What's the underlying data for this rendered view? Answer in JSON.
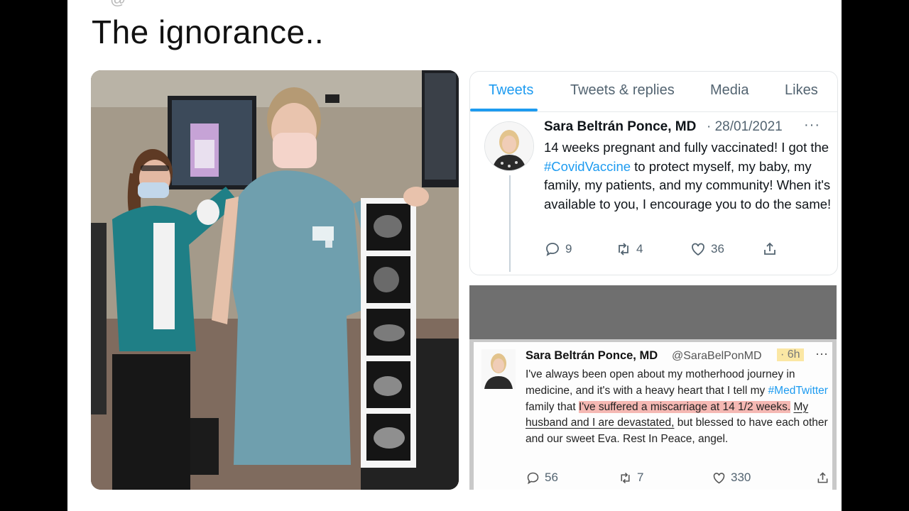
{
  "caption": "The ignorance..",
  "cut_header": "@",
  "profile": {
    "tabs": [
      "Tweets",
      "Tweets & replies",
      "Media",
      "Likes"
    ],
    "active_tab": "Tweets"
  },
  "tweet1": {
    "name": "Sara Beltrán Ponce, MD",
    "date": "· 28/01/2021",
    "more": "···",
    "body_before": "14 weeks pregnant and fully vaccinated! I got the ",
    "hashtag": "#CovidVaccine",
    "body_after": " to protect myself, my baby, my family, my patients, and my community! When it's available to you, I encourage you to do the same!",
    "replies": "9",
    "retweets": "4",
    "likes": "36"
  },
  "tweet2": {
    "name": "Sara Beltrán Ponce, MD",
    "handle": "@SaraBelPonMD",
    "time": "· 6h",
    "more": "···",
    "body_part1": "I've always been open about my motherhood journey in medicine, and it's with a heavy heart that I tell my ",
    "hashtag": "#MedTwitter",
    "body_part2": " family that ",
    "highlight": "I've suffered a miscarriage at 14 1/2 weeks.",
    "underlined": "My husband and I are devastated,",
    "body_part3": " but blessed to have each other and our sweet Eva. Rest In Peace, angel.",
    "replies": "56",
    "retweets": "7",
    "likes": "330"
  },
  "colors": {
    "accent": "#1d9bf0",
    "scrubs": "#6f9fae",
    "highlight": "#f5b8b3",
    "time_highlight": "#fbe7a4"
  },
  "icons": [
    "reply-icon",
    "retweet-icon",
    "like-icon",
    "share-icon",
    "more-icon"
  ]
}
